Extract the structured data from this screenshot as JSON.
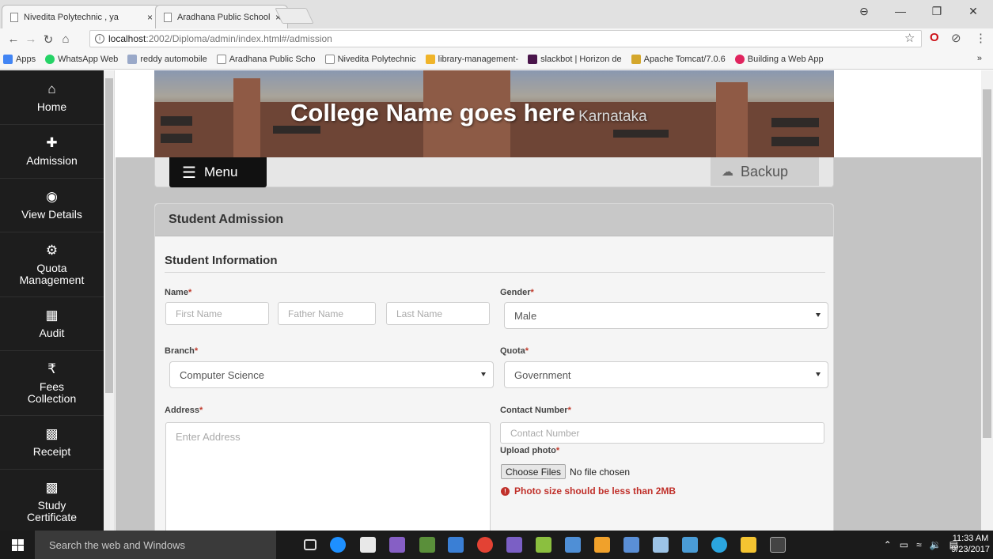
{
  "browser": {
    "tabs": [
      {
        "title": "Nivedita Polytechnic , ya",
        "close": "×"
      },
      {
        "title": "Aradhana Public School",
        "close": "×"
      }
    ],
    "url_host": "localhost",
    "url_rest": ":2002/Diploma/admin/index.html#/admission",
    "bookmarks": [
      {
        "label": "Apps",
        "color": "#4285f4"
      },
      {
        "label": "WhatsApp Web",
        "color": "#25d366"
      },
      {
        "label": "reddy automobile",
        "color": "#9aa9c9"
      },
      {
        "label": "Aradhana Public Scho",
        "color": "#bbbbbb"
      },
      {
        "label": "Nivedita Polytechnic",
        "color": "#bbbbbb"
      },
      {
        "label": "library-management-",
        "color": "#f0b429"
      },
      {
        "label": "slackbot | Horizon de",
        "color": "#4a154b"
      },
      {
        "label": "Apache Tomcat/7.0.6",
        "color": "#d4a72c"
      },
      {
        "label": "Building a Web App",
        "color": "#e0245e"
      }
    ],
    "bookmarks_more": "»"
  },
  "sidebar": {
    "items": [
      {
        "label": "Home",
        "icon": "home-icon",
        "glyph": "🏠"
      },
      {
        "label": "Admission",
        "icon": "add-user-icon",
        "glyph": "👤"
      },
      {
        "label": "View Details",
        "icon": "eye-icon",
        "glyph": "👁"
      },
      {
        "label": "Quota\nManagement",
        "icon": "gears-icon",
        "glyph": "⚙"
      },
      {
        "label": "Audit",
        "icon": "grid-icon",
        "glyph": "▦"
      },
      {
        "label": "Fees\nCollection",
        "icon": "rupee-icon",
        "glyph": "₹"
      },
      {
        "label": "Receipt",
        "icon": "money-icon",
        "glyph": "💵"
      },
      {
        "label": "Study\nCertificate",
        "icon": "money-icon",
        "glyph": "💵"
      }
    ]
  },
  "banner": {
    "title": "College Name goes here",
    "subtitle": "Karnataka"
  },
  "menubar": {
    "menu_label": "Menu",
    "backup_label": "Backup"
  },
  "form": {
    "panel_title": "Student Admission",
    "section_title": "Student Information",
    "name_label": "Name",
    "first_name_placeholder": "First Name",
    "father_name_placeholder": "Father Name",
    "last_name_placeholder": "Last Name",
    "gender_label": "Gender",
    "gender_value": "Male",
    "branch_label": "Branch",
    "branch_value": "Computer Science",
    "quota_label": "Quota",
    "quota_value": "Government",
    "address_label": "Address",
    "address_placeholder": "Enter Address",
    "contact_label": "Contact Number",
    "contact_placeholder": "Contact Number",
    "photo_label": "Upload photo",
    "choose_files_label": "Choose Files",
    "no_file_text": "No file chosen",
    "photo_warning": "Photo size should be less than 2MB",
    "required_mark": "*"
  },
  "taskbar": {
    "search_placeholder": "Search the web and Windows",
    "time": "11:33 AM",
    "date": "9/23/2017"
  },
  "colors": {
    "sidebar_bg": "#1d1d1d",
    "required": "#c0392b",
    "warning": "#c0302a"
  }
}
